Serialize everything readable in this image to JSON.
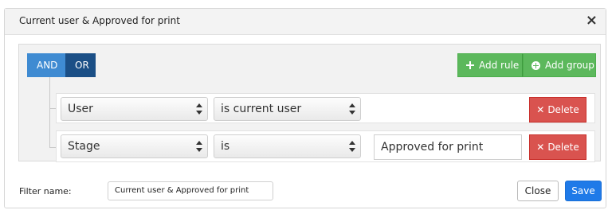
{
  "dialog": {
    "title": "Current user & Approved for print",
    "close_glyph": "×"
  },
  "builder": {
    "conditions": [
      {
        "label": "AND",
        "selected": true
      },
      {
        "label": "OR",
        "selected": false
      }
    ],
    "add_rule_label": "Add rule",
    "add_group_label": "Add group",
    "rules": [
      {
        "field": "User",
        "operator": "is current user",
        "value": null,
        "delete_label": "Delete"
      },
      {
        "field": "Stage",
        "operator": "is",
        "value": "Approved for print",
        "delete_label": "Delete"
      }
    ]
  },
  "footer": {
    "filter_name_label": "Filter name:",
    "filter_name_value": "Current user & Approved for print",
    "close_label": "Close",
    "save_label": "Save"
  },
  "colors": {
    "and_active": "#3f8bd2",
    "or": "#1b4f86",
    "green": "#5cb85c",
    "delete_red": "#d9534f",
    "save_blue": "#1f7ae8"
  }
}
